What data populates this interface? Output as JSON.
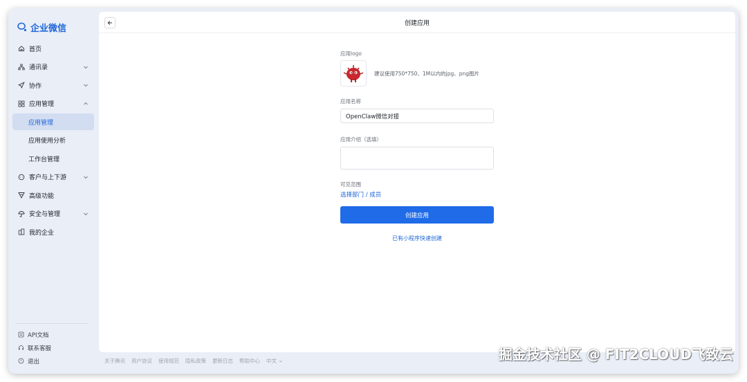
{
  "brand": {
    "name": "企业微信",
    "color": "#1f65d8"
  },
  "sidebar": {
    "items": [
      {
        "label": "首页",
        "icon": "home-icon"
      },
      {
        "label": "通讯录",
        "icon": "org-chart-icon",
        "expandable": true
      },
      {
        "label": "协作",
        "icon": "send-icon",
        "expandable": true
      },
      {
        "label": "应用管理",
        "icon": "grid-icon",
        "expandable": true,
        "expanded": true
      },
      {
        "label": "应用管理",
        "sub": true,
        "active": true
      },
      {
        "label": "应用使用分析",
        "sub": true
      },
      {
        "label": "工作台管理",
        "sub": true
      },
      {
        "label": "客户与上下游",
        "icon": "chat-icon",
        "expandable": true
      },
      {
        "label": "高级功能",
        "icon": "funnel-icon"
      },
      {
        "label": "安全与管理",
        "icon": "umbrella-icon",
        "expandable": true
      },
      {
        "label": "我的企业",
        "icon": "building-icon"
      }
    ],
    "bottom": [
      {
        "label": "API文档",
        "icon": "doc-icon"
      },
      {
        "label": "联系客服",
        "icon": "headset-icon"
      },
      {
        "label": "退出",
        "icon": "power-icon"
      }
    ]
  },
  "page": {
    "title": "创建应用"
  },
  "form": {
    "logo_label": "应用logo",
    "logo_hint": "建议使用750*750、1M以内的jpg、png图片",
    "name_label": "应用名称",
    "name_value": "OpenClaw微信对接",
    "intro_label": "应用介绍（选填）",
    "intro_value": "",
    "scope_label": "可见范围",
    "scope_link": "选择部门 / 成员",
    "submit_label": "创建应用",
    "mini_program_link": "已有小程序快速创建"
  },
  "footer": {
    "links": [
      "关于腾讯",
      "用户协议",
      "使用规范",
      "隐私政策",
      "更新日志",
      "帮助中心",
      "中文"
    ]
  },
  "watermark": "掘金技术社区 @ FIT2CLOUD飞致云",
  "colors": {
    "primary": "#1f6be8",
    "sidebar_bg": "#e9eef7",
    "active_bg": "#d2ddf2",
    "logo_red": "#c8282e"
  }
}
